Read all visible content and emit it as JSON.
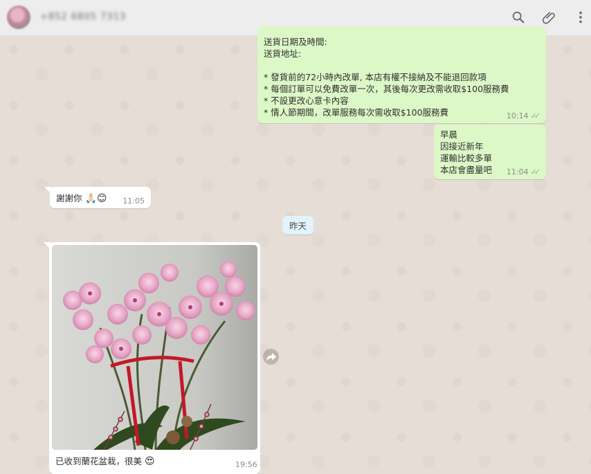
{
  "header": {
    "contact_name": "+852 6805 7313",
    "icons": [
      "search-icon",
      "attach-icon",
      "menu-icon"
    ]
  },
  "messages": {
    "order_info": {
      "lines": [
        "送貨日期及時間:",
        "送貨地址:",
        "",
        "* 發貨前的72小時內改單, 本店有權不接納及不能退回款項",
        "* 每個訂單可以免費改單一次，其後每次更改需收取$100服務費",
        "* 不設更改心意卡內容",
        "* 情人節期間，改單服務每次需收取$100服務費"
      ],
      "time": "10:14"
    },
    "morning": {
      "lines": [
        "早晨",
        "因接近新年",
        "運輸比較多單",
        "本店會盡量吧"
      ],
      "time": "11:04"
    },
    "thanks": {
      "text": "謝謝你",
      "emoji": "🙏🏻😊",
      "time": "11:05"
    },
    "date_divider": "昨天",
    "photo_msg": {
      "caption": "已收到蘭花盆栽，很美",
      "emoji": "😍",
      "time": "19:56"
    }
  },
  "colors": {
    "outgoing_bubble": "#dcf8c6",
    "incoming_bubble": "#ffffff",
    "date_chip": "#e1f3fb",
    "chat_background": "#e6ded6"
  }
}
